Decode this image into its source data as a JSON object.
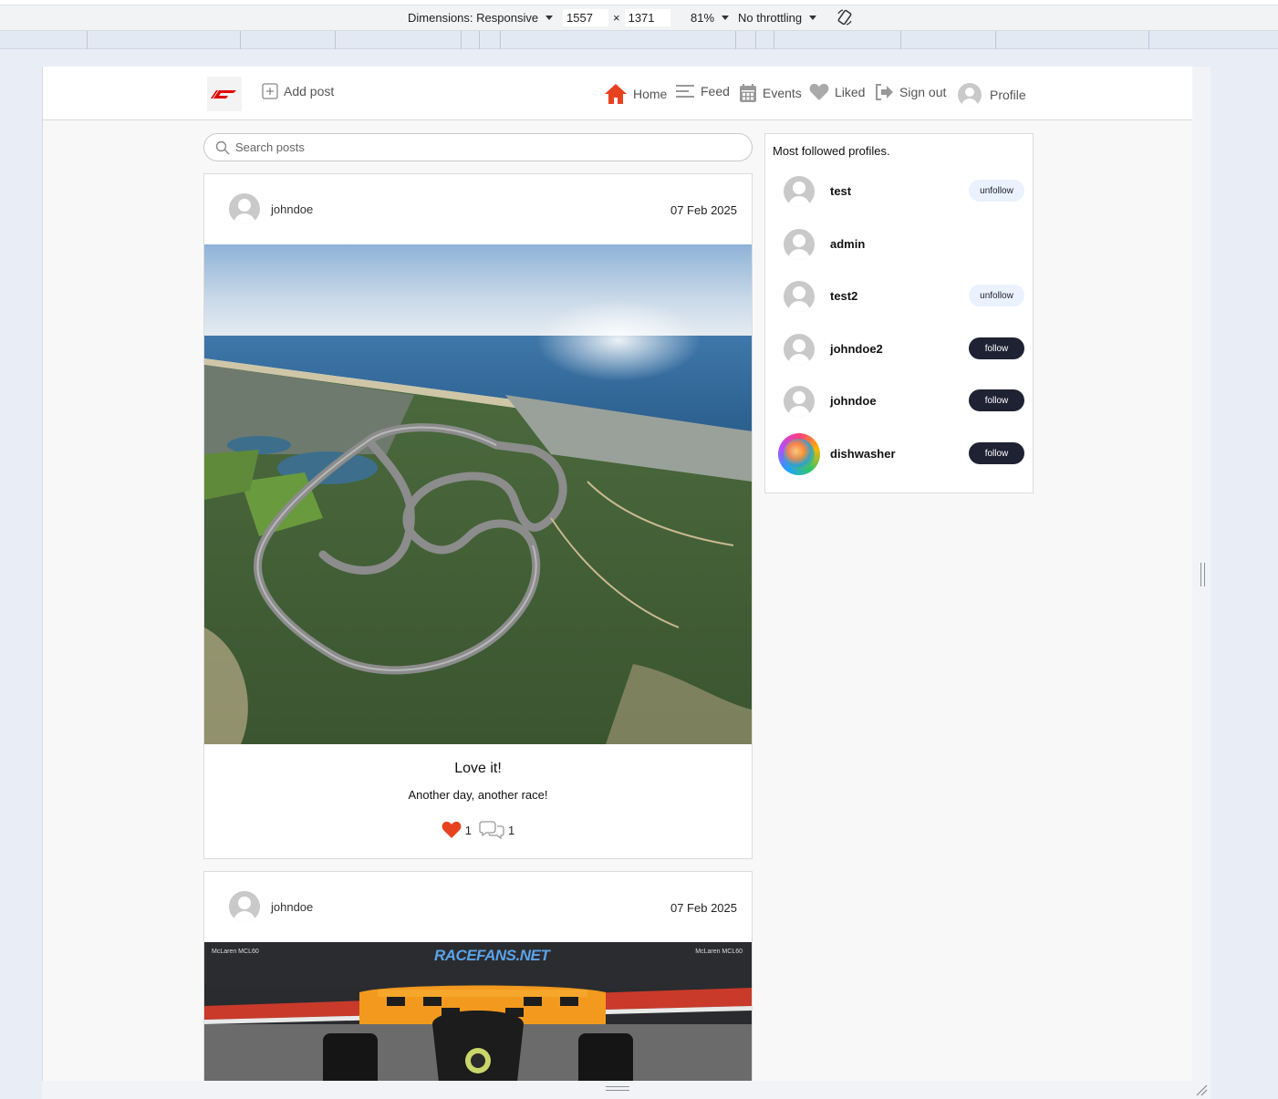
{
  "devtools": {
    "dimensions_label": "Dimensions: Responsive",
    "width": "1557",
    "times": "×",
    "height": "1371",
    "zoom": "81%",
    "throttling": "No throttling"
  },
  "navbar": {
    "add_post": "Add post",
    "home": "Home",
    "feed": "Feed",
    "events": "Events",
    "liked": "Liked",
    "sign_out": "Sign out",
    "profile": "Profile",
    "accent_color": "#e6421f"
  },
  "search": {
    "placeholder": "Search posts"
  },
  "posts": [
    {
      "owner": "johndoe",
      "date": "07 Feb 2025",
      "title": "Love it!",
      "content": "Another day, another race!",
      "likes": "1",
      "comments": "1"
    },
    {
      "owner": "johndoe",
      "date": "07 Feb 2025",
      "image_caption_left": "McLaren MCL60",
      "image_caption_right": "McLaren MCL60",
      "image_brand": "RACEFANS.NET"
    }
  ],
  "sidebar": {
    "title": "Most followed profiles.",
    "profiles": [
      {
        "name": "test",
        "action": "unfollow"
      },
      {
        "name": "admin",
        "action": ""
      },
      {
        "name": "test2",
        "action": "unfollow"
      },
      {
        "name": "johndoe2",
        "action": "follow"
      },
      {
        "name": "johndoe",
        "action": "follow"
      },
      {
        "name": "dishwasher",
        "action": "follow"
      }
    ]
  }
}
